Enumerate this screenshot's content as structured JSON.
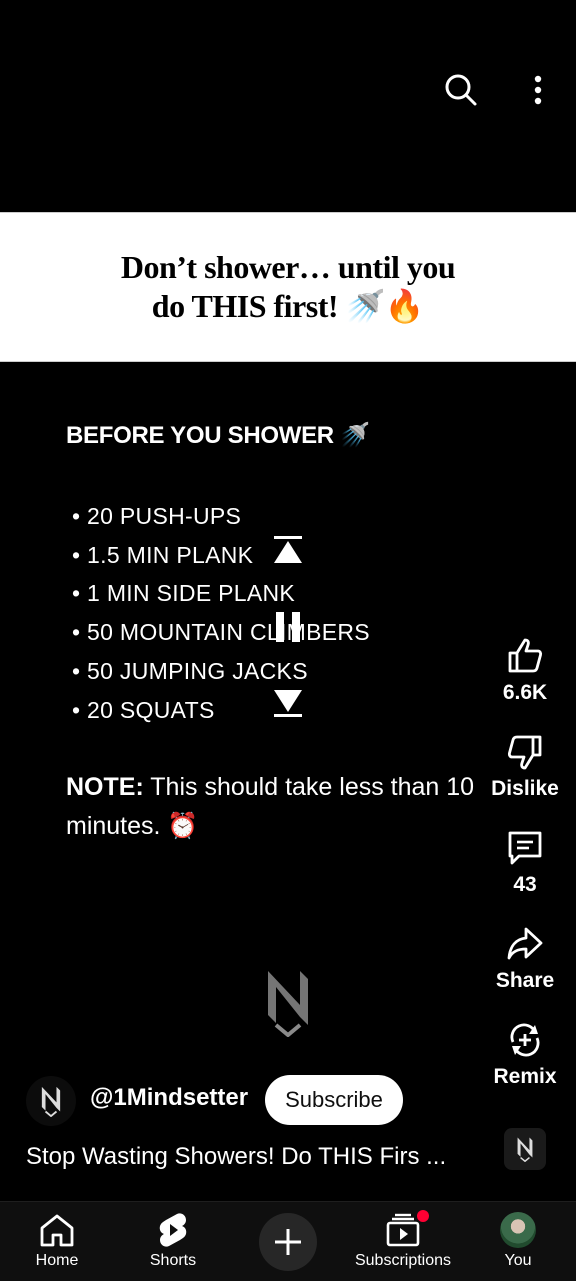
{
  "top_bar": {
    "search_icon": "search-icon",
    "more_icon": "more-vertical-icon"
  },
  "banner": {
    "line1": "Don’t shower… until you",
    "line2": "do THIS first! 🚿🔥"
  },
  "overlay": {
    "heading": "BEFORE YOU SHOWER 🚿",
    "items": [
      "• 20 PUSH-UPS",
      "• 1.5 MIN PLANK",
      "• 1 MIN SIDE PLANK",
      "• 50 MOUNTAIN CLIMBERS",
      "• 50 JUMPING JACKS",
      "• 20 SQUATS"
    ],
    "note_label": "NOTE:",
    "note_text": " This should take less than 10 minutes. ⏰"
  },
  "actions": {
    "like_count": "6.6K",
    "dislike_label": "Dislike",
    "comment_count": "43",
    "share_label": "Share",
    "remix_label": "Remix"
  },
  "channel": {
    "handle": "@1Mindsetter",
    "subscribe_label": "Subscribe"
  },
  "video": {
    "title": "Stop Wasting Showers! Do THIS Firs ..."
  },
  "nav": {
    "home": "Home",
    "shorts": "Shorts",
    "subscriptions": "Subscriptions",
    "you": "You"
  },
  "colors": {
    "background": "#000000",
    "nav_background": "#0f0f0f",
    "badge": "#ff0033",
    "create_button": "#272727"
  }
}
